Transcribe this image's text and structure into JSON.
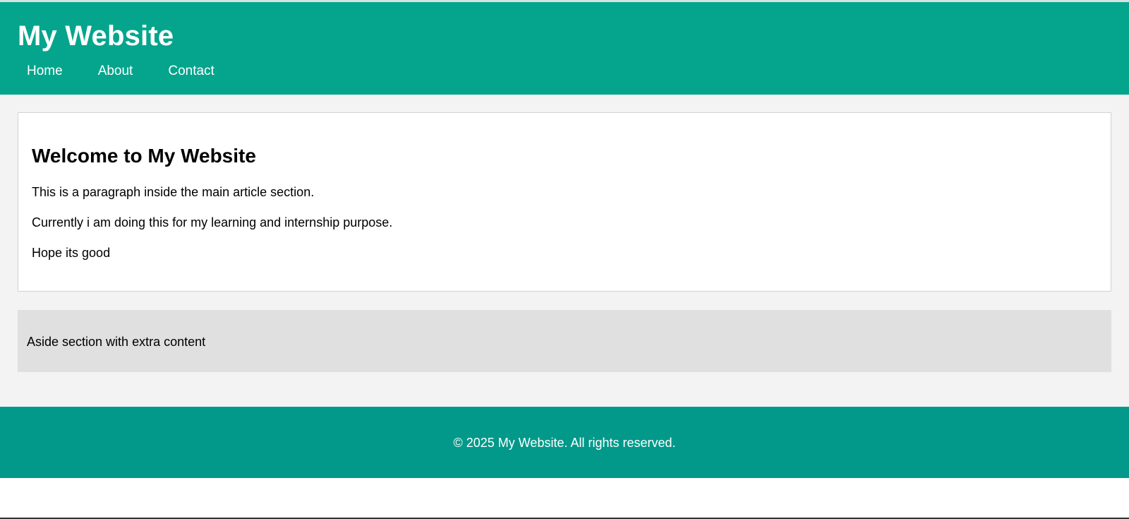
{
  "header": {
    "title": "My Website",
    "nav": [
      {
        "label": "Home"
      },
      {
        "label": "About"
      },
      {
        "label": "Contact"
      }
    ]
  },
  "article": {
    "heading": "Welcome to My Website",
    "paragraphs": [
      "This is a paragraph inside the main article section.",
      "Currently i am doing this for my learning and internship purpose.",
      "Hope its good"
    ]
  },
  "aside": {
    "text": "Aside section with extra content"
  },
  "footer": {
    "text": "© 2025 My Website. All rights reserved."
  },
  "colors": {
    "header_bg": "#04a58c",
    "footer_bg": "#02998a",
    "content_bg": "#f3f3f3",
    "aside_bg": "#e0e0e0"
  }
}
